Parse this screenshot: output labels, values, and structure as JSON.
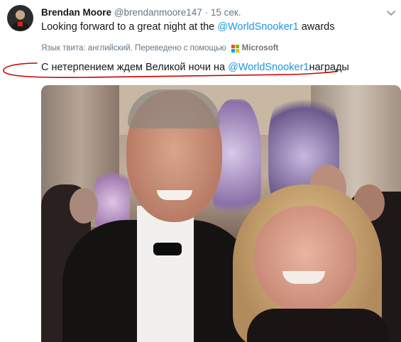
{
  "tweet": {
    "author_name": "Brendan Moore",
    "author_handle": "@brendanmoore147",
    "separator": "·",
    "time": "15 сек.",
    "text_prefix": "Looking forward to a great night at the ",
    "text_mention": "@WorldSnooker1",
    "text_suffix": " awards"
  },
  "translation": {
    "notice": "Язык твита: английский. Переведено с помощью",
    "provider": "Microsoft",
    "text_prefix": "С нетерпением ждем Великой ночи на ",
    "text_mention": "@WorldSnooker1",
    "text_suffix": "награды"
  },
  "icons": {
    "menu": "chevron-down-icon",
    "translator_logo": "microsoft-logo-icon"
  },
  "colors": {
    "link": "#1b95e0",
    "secondary_text": "#657786",
    "annotation": "#cc0000"
  }
}
